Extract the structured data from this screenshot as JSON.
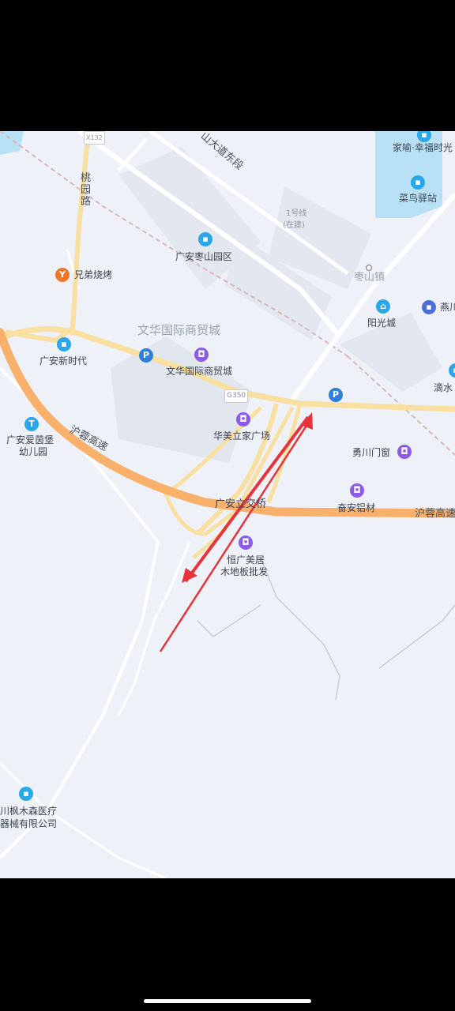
{
  "map": {
    "roads": {
      "taoyuan_road": "桃园路",
      "huchong_expressway_left": "沪蓉高速",
      "huchong_expressway_right": "沪蓉高速",
      "shan_avenue_east": "山大道东段",
      "g350": "G350",
      "x132": "X132"
    },
    "metro": {
      "line": "1号线",
      "status": "(在建)"
    },
    "areas": {
      "wenhua_area": "文华国际商贸城",
      "zaoshan_town": "枣山镇",
      "interchange": "广安立交桥"
    },
    "pois": [
      {
        "label": "兄弟烧烤",
        "icon": "restaurant-icon"
      },
      {
        "label": "广安新时代",
        "icon": "building-icon"
      },
      {
        "label": "广安枣山园区",
        "icon": "building-icon"
      },
      {
        "label": "文华国际商贸城",
        "icon": "shopping-icon"
      },
      {
        "label": "华美立家广场",
        "icon": "shopping-icon"
      },
      {
        "label": "广安爱茵堡",
        "label2": "幼儿园",
        "icon": "school-icon"
      },
      {
        "label": "阳光城",
        "icon": "residential-icon"
      },
      {
        "label": "燕川",
        "icon": "hotel-icon"
      },
      {
        "label": "家喻·幸福时光",
        "icon": "building-icon"
      },
      {
        "label": "菜鸟驿站",
        "icon": "package-icon"
      },
      {
        "label": "滴水",
        "icon": "building-icon"
      },
      {
        "label": "勇川门窗",
        "icon": "shopping-icon"
      },
      {
        "label": "奋安铝材",
        "icon": "shopping-icon"
      },
      {
        "label": "恒广美居",
        "label2": "木地板批发",
        "icon": "shopping-icon"
      },
      {
        "label": "川枫木森医疗",
        "label2": "器械有限公司",
        "icon": "building-icon"
      }
    ],
    "parking_label": "P",
    "colors": {
      "background": "#eef1f8",
      "expressway": "#f8b06b",
      "main_road": "#f9dfa0",
      "arrow": "#e8333a",
      "water": "#b9e1f5"
    }
  }
}
